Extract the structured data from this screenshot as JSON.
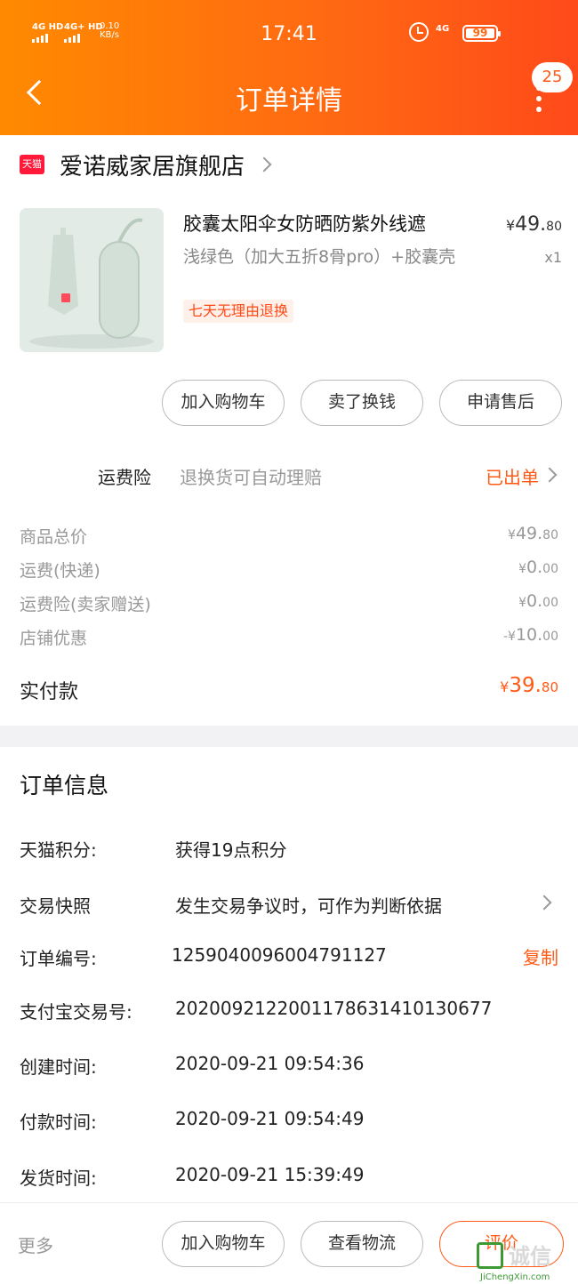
{
  "status_bar": {
    "signal_1": "4G HD",
    "signal_2": "4G+ HD",
    "net_speed": "0.10",
    "net_speed_unit": "KB/s",
    "time": "17:41",
    "network": "4G",
    "battery": "99"
  },
  "header": {
    "title": "订单详情",
    "badge_count": "25"
  },
  "shop": {
    "badge": "天猫",
    "name": "爱诺威家居旗舰店"
  },
  "product": {
    "title": "胶囊太阳伞女防晒防紫外线遮",
    "spec": "浅绿色（加大五折8骨pro）+胶囊壳",
    "tag": "七天无理由退换",
    "price_currency": "¥",
    "price_int": "49.",
    "price_dec": "80",
    "qty": "x1",
    "image_colors": {
      "bg": "#dfe8e3",
      "item": "#c9dacf",
      "accent": "#ff4a5a"
    }
  },
  "product_actions": {
    "add_cart": "加入购物车",
    "resell": "卖了换钱",
    "after_sale": "申请售后"
  },
  "insurance": {
    "label": "运费险",
    "desc": "退换货可自动理赔",
    "status": "已出单"
  },
  "costs": [
    {
      "label": "商品总价",
      "prefix": "¥",
      "int": "49.",
      "dec": "80"
    },
    {
      "label": "运费(快递)",
      "prefix": "¥",
      "int": "0.",
      "dec": "00"
    },
    {
      "label": "运费险(卖家赠送)",
      "prefix": "¥",
      "int": "0.",
      "dec": "00"
    },
    {
      "label": "店铺优惠",
      "prefix": "-¥",
      "int": "10.",
      "dec": "00"
    }
  ],
  "paid": {
    "label": "实付款",
    "prefix": "¥",
    "int": "39.",
    "dec": "80"
  },
  "order_info": {
    "title": "订单信息",
    "rows": [
      {
        "label": "天猫积分:",
        "value": "获得19点积分"
      },
      {
        "label": "交易快照",
        "value": "发生交易争议时，可作为判断依据"
      },
      {
        "label": "订单编号:",
        "value": "1259040096004791127"
      },
      {
        "label": "支付宝交易号:",
        "value": "2020092122001178631410130677"
      },
      {
        "label": "创建时间:",
        "value": "2020-09-21 09:54:36"
      },
      {
        "label": "付款时间:",
        "value": "2020-09-21 09:54:49"
      },
      {
        "label": "发货时间:",
        "value": "2020-09-21 15:39:49"
      }
    ],
    "copy_label": "复制"
  },
  "bottom_bar": {
    "more": "更多",
    "add_cart": "加入购物车",
    "logistics": "查看物流",
    "review": "评价"
  },
  "watermark": {
    "text": "诚信",
    "sub": "JiChengXin.com"
  },
  "colors": {
    "accent": "#ff5a16",
    "header_start": "#ff8a00",
    "header_end": "#ff4a1a",
    "tmall_red": "#ff1a3a",
    "watermark_green": "#3c9a35"
  }
}
